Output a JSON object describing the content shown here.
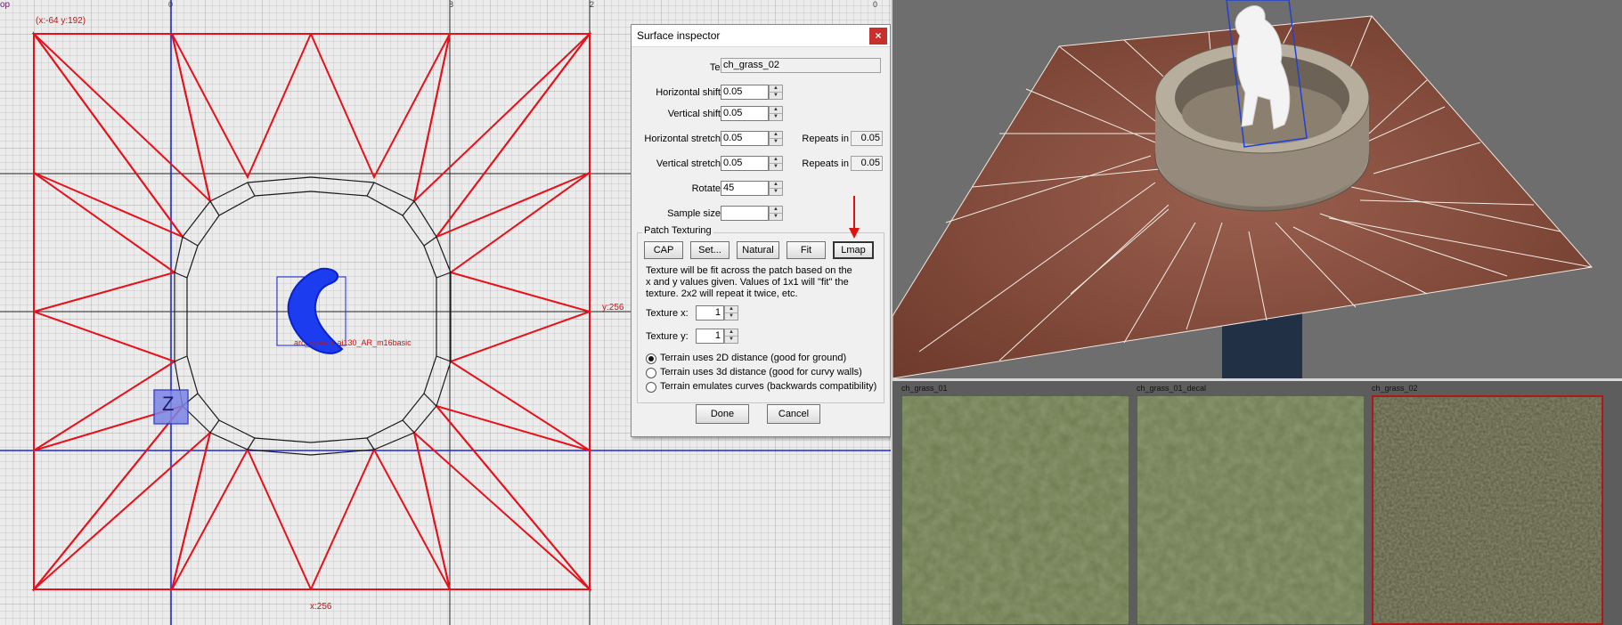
{
  "grid_view": {
    "view_name": "op",
    "cursor_coords": "(x:-64 y:192)",
    "ruler_numbers": [
      "0",
      "8",
      "2",
      "0"
    ],
    "y_measure": "y:256",
    "x_measure": "x:256",
    "entity_label": "arc_spawn_ai130_AR_m16basic",
    "gizmo_axis": "Z"
  },
  "surface_inspector": {
    "title": "Surface inspector",
    "close": "×",
    "texture_label": "Texture",
    "texture_value": "ch_grass_02",
    "horizontal_shift_label": "Horizontal shift",
    "horizontal_shift": "0.05",
    "vertical_shift_label": "Vertical shift",
    "vertical_shift": "0.05",
    "horizontal_stretch_label": "Horizontal stretch",
    "horizontal_stretch": "0.05",
    "vertical_stretch_label": "Vertical stretch",
    "vertical_stretch": "0.05",
    "repeats_in_label": "Repeats in",
    "repeats_in_h": "0.05",
    "repeats_in_v": "0.05",
    "rotate_label": "Rotate",
    "rotate": "45",
    "sample_size_label": "Sample size",
    "sample_size": "",
    "patch_texturing": {
      "title": "Patch Texturing",
      "buttons": [
        "CAP",
        "Set...",
        "Natural",
        "Fit",
        "Lmap"
      ],
      "help_lines": [
        "Texture will be fit across the patch based on the",
        "x and y values given. Values of 1x1 will \"fit\" the",
        "texture. 2x2 will repeat it twice, etc."
      ],
      "texture_x_label": "Texture x:",
      "texture_x": "1",
      "texture_y_label": "Texture y:",
      "texture_y": "1",
      "radio_options": [
        {
          "label": "Terrain uses 2D distance (good for ground)",
          "selected": true
        },
        {
          "label": "Terrain uses 3d distance (good for curvy walls)",
          "selected": false
        },
        {
          "label": "Terrain emulates curves (backwards compatibility)",
          "selected": false
        }
      ]
    },
    "done_label": "Done",
    "cancel_label": "Cancel",
    "annotation_arrow_color": "#e01010"
  },
  "texture_browser": {
    "textures": [
      {
        "name": "ch_grass_01",
        "selected": false
      },
      {
        "name": "ch_grass_01_decal",
        "selected": false
      },
      {
        "name": "ch_grass_02",
        "selected": true
      }
    ]
  },
  "colors": {
    "brush_red": "#e8101a",
    "axis_blue": "#1c28d8",
    "selection_red": "#b01818"
  }
}
